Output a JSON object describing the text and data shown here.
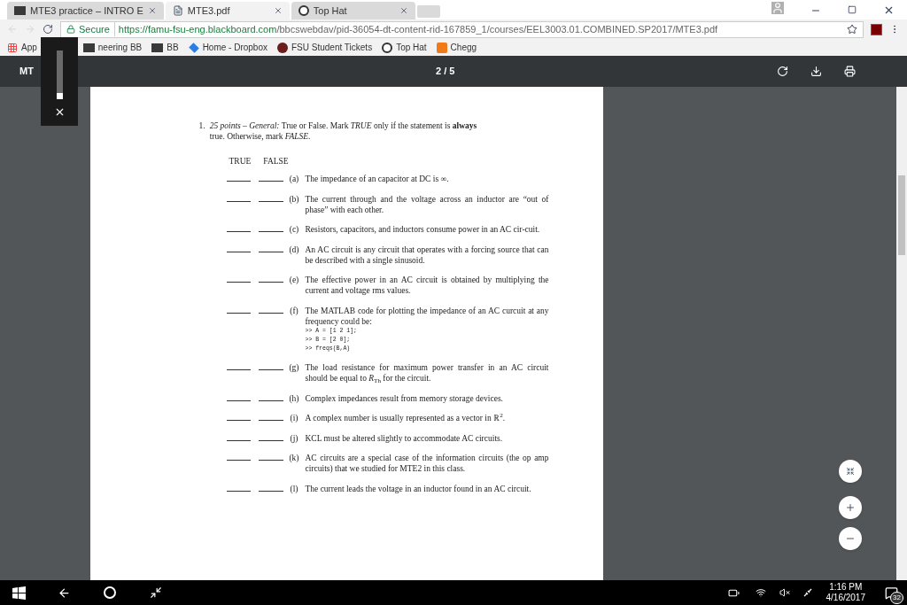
{
  "tabs": [
    {
      "label": "MTE3 practice – INTRO E",
      "selected": false,
      "kind": "bb"
    },
    {
      "label": "MTE3.pdf",
      "selected": true,
      "kind": "doc"
    },
    {
      "label": "Top Hat",
      "selected": false,
      "kind": "tophat"
    }
  ],
  "address": {
    "secure_label": "Secure",
    "host": "https://famu-fsu-eng.blackboard.com",
    "path": "/bbcswebdav/pid-36054-dt-content-rid-167859_1/courses/EEL3003.01.COMBINED.SP2017/MTE3.pdf"
  },
  "bookmarks": [
    {
      "label": "App",
      "kind": "apps"
    },
    {
      "label": "neering BB",
      "kind": "bb"
    },
    {
      "label": "BB",
      "kind": "bb"
    },
    {
      "label": "Home - Dropbox",
      "kind": "dropbox"
    },
    {
      "label": "FSU Student Tickets",
      "kind": "fsu"
    },
    {
      "label": "Top Hat",
      "kind": "tophat"
    },
    {
      "label": "Chegg",
      "kind": "chegg"
    }
  ],
  "viewer": {
    "title": "MT",
    "page_indicator": "2 / 5"
  },
  "question": {
    "number": "1.",
    "intro": "*25 points – General:* True or False. Mark *TRUE* only if the statement is **always** true. Otherwise, mark *FALSE*.",
    "true_heading": "TRUE",
    "false_heading": "FALSE",
    "items": [
      {
        "letter": "(a)",
        "text": "The impedance of an capacitor at DC is ∞."
      },
      {
        "letter": "(b)",
        "text": "The current through and the voltage across an inductor are “out of phase” with each other."
      },
      {
        "letter": "(c)",
        "text": "Resistors, capacitors, and inductors consume power in an AC cir-cuit."
      },
      {
        "letter": "(d)",
        "text": "An AC circuit is any circuit that operates with a forcing source that can be described with a single sinusoid."
      },
      {
        "letter": "(e)",
        "text": "The effective power in an AC circuit is obtained by multiplying the current and voltage rms values."
      },
      {
        "letter": "(f)",
        "text": "The MATLAB code for plotting the impedance of an AC curcuit at any frequency could be:",
        "code": [
          ">> A = [1 2 1];",
          ">> B = [2 0];",
          ">> freqs(B,A)"
        ]
      },
      {
        "letter": "(g)",
        "text": "The load resistance for maximum power transfer in an AC circuit should be equal to *R*$_{Th}$ for the circuit."
      },
      {
        "letter": "(h)",
        "text": "Complex impedances result from memory storage devices."
      },
      {
        "letter": "(i)",
        "text": "A complex number is usually represented as a vector in ℝ$^{2}$."
      },
      {
        "letter": "(j)",
        "text": "KCL must be altered slightly to accommodate AC circuits."
      },
      {
        "letter": "(k)",
        "text": "AC circuits are a special case of the information circuits (the op amp circuits) that we studied for MTE2 in this class."
      },
      {
        "letter": "(l)",
        "text": "The current leads the voltage in an inductor found in an AC circuit."
      }
    ]
  },
  "taskbar": {
    "time": "1:16 PM",
    "date": "4/16/2017",
    "notification_count": "32"
  }
}
